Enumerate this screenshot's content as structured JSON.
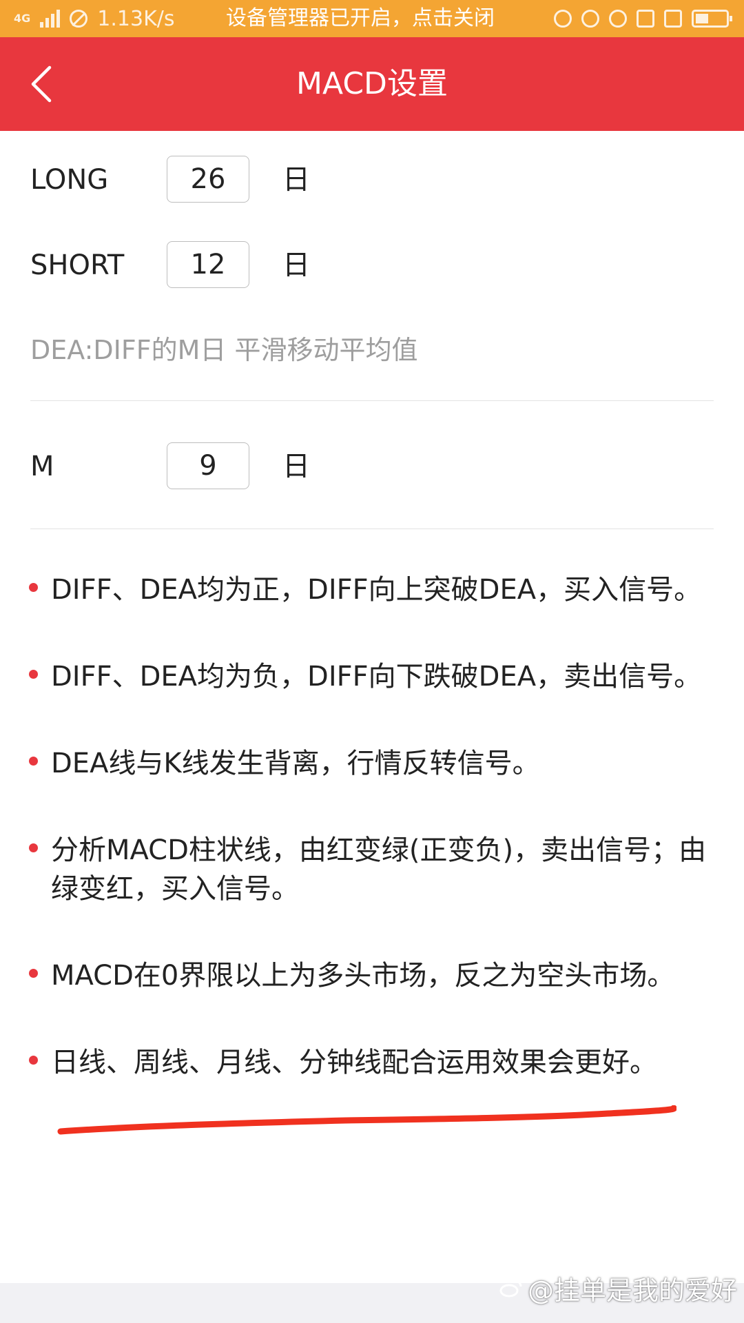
{
  "status_bar": {
    "network_type": "4G",
    "speed": "1.13K/s",
    "notification": "设备管理器已开启，点击关闭"
  },
  "header": {
    "title": "MACD设置"
  },
  "settings": {
    "long": {
      "label": "LONG",
      "value": "26",
      "unit": "日"
    },
    "short": {
      "label": "SHORT",
      "value": "12",
      "unit": "日"
    },
    "dea_note": "DEA:DIFF的M日 平滑移动平均值",
    "m": {
      "label": "M",
      "value": "9",
      "unit": "日"
    }
  },
  "tips": [
    "DIFF、DEA均为正，DIFF向上突破DEA，买入信号。",
    "DIFF、DEA均为负，DIFF向下跌破DEA，卖出信号。",
    "DEA线与K线发生背离，行情反转信号。",
    "分析MACD柱状线，由红变绿(正变负)，卖出信号；由绿变红，买入信号。",
    "MACD在0界限以上为多头市场，反之为空头市场。",
    "日线、周线、月线、分钟线配合运用效果会更好。"
  ],
  "watermark": "@挂单是我的爱好",
  "colors": {
    "status_bar": "#f4a533",
    "header": "#e8373e",
    "bullet": "#e8373e",
    "annotation_stroke": "#f0311f"
  }
}
